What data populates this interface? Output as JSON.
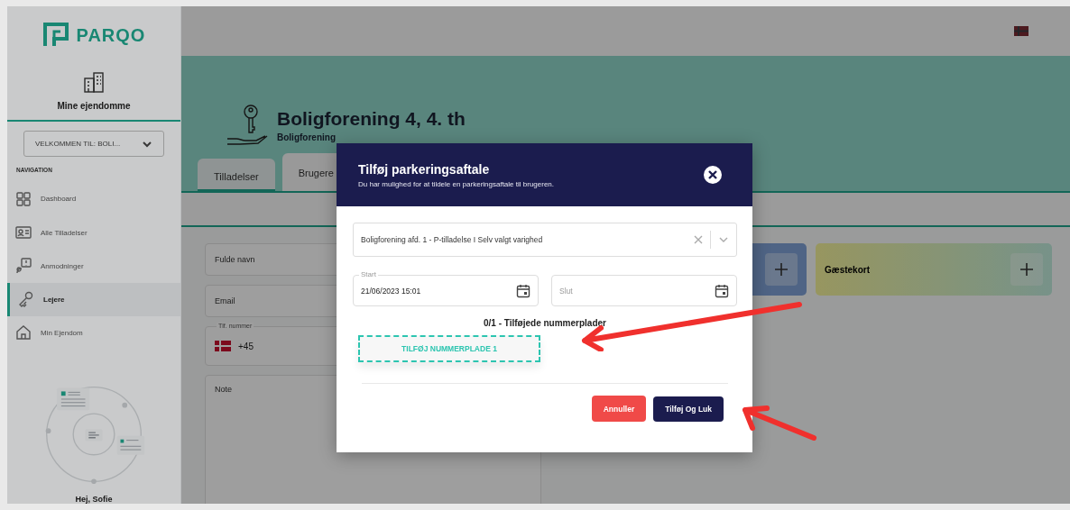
{
  "sidebar": {
    "logo": "PARQO",
    "property_label": "Mine ejendomme",
    "selector": "VELKOMMEN TIL: BOLI...",
    "nav_heading": "NAVIGATION",
    "items": [
      {
        "label": "Dashboard",
        "selected": false
      },
      {
        "label": "Alle Tilladelser",
        "selected": false
      },
      {
        "label": "Anmodninger",
        "selected": false
      },
      {
        "label": "Lejere",
        "selected": true
      },
      {
        "label": "Min Ejendom",
        "selected": false
      }
    ],
    "greeting": "Hej, Sofie"
  },
  "header": {
    "title": "Boligforening 4, 4. th",
    "subtitle": "Boligforening"
  },
  "tabs": [
    {
      "label": "Tilladelser",
      "selected": false
    },
    {
      "label": "Brugere",
      "selected": true
    }
  ],
  "form": {
    "name": {
      "placeholder": "Fulde navn"
    },
    "email": {
      "placeholder": "Email"
    },
    "phone": {
      "label": "Tlf. nummer",
      "value": "+45"
    },
    "note": {
      "placeholder": "Note"
    }
  },
  "cards": [
    {
      "kind": "blue"
    },
    {
      "label": "Gæstekort",
      "kind": "guest"
    }
  ],
  "modal": {
    "title": "Tilføj parkeringsaftale",
    "subtitle": "Du har mulighed for at tildele en parkeringsaftale til brugeren.",
    "agreement": {
      "value": "Boligforening afd. 1 - P-tilladelse I Selv valgt varighed"
    },
    "start": {
      "label": "Start",
      "value": "21/06/2023 15:01"
    },
    "end": {
      "placeholder": "Slut"
    },
    "plates_heading": "0/1 - Tilføjede nummerplader",
    "add_plate": "TILFØJ NUMMERPLADE 1",
    "buttons": [
      {
        "label": "Annuller",
        "kind": "cancel"
      },
      {
        "label": "Tilføj Og Luk",
        "kind": "primary"
      }
    ]
  }
}
